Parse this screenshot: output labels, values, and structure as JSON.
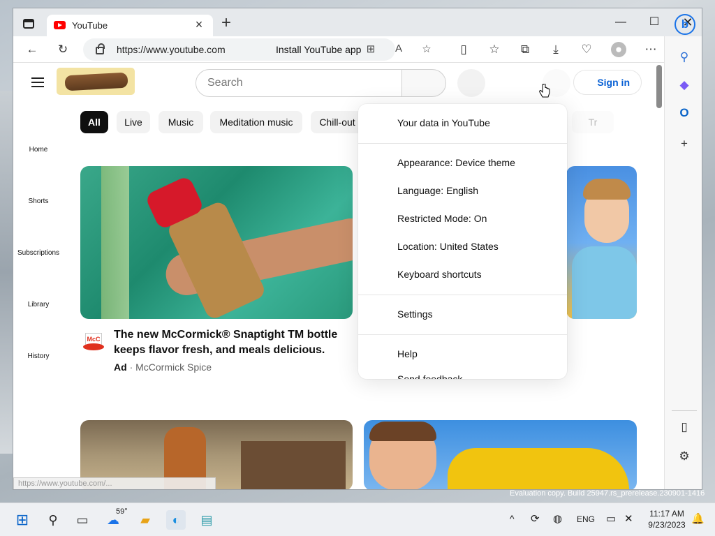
{
  "browser": {
    "tab_title": "YouTube",
    "url": "https://www.youtube.com",
    "install_prompt": "Install YouTube app"
  },
  "youtube": {
    "search_placeholder": "Search",
    "sign_in": "Sign in",
    "chips": [
      "All",
      "Live",
      "Music",
      "Meditation music",
      "Chill-out",
      "Tr"
    ],
    "sidenav": [
      "Home",
      "Shorts",
      "Subscriptions",
      "Library",
      "History"
    ],
    "video1": {
      "title": "The new McCormick® Snaptight TM bottle keeps flavor fresh, and meals delicious.",
      "ad_label": "Ad",
      "separator": "·",
      "channel": "McCormick Spice",
      "channel_badge": "McC"
    },
    "status_url": "https://www.youtube.com/..."
  },
  "menu": {
    "items": [
      "Your data in YouTube",
      "Appearance: Device theme",
      "Language: English",
      "Restricted Mode: On",
      "Location: United States",
      "Keyboard shortcuts",
      "Settings",
      "Help",
      "Send feedback"
    ]
  },
  "desktop": {
    "eval_text": "Evaluation copy. Build 25947.rs_prerelease.230901-1416"
  },
  "taskbar": {
    "weather": "59°",
    "lang": "ENG",
    "time": "11:17 AM",
    "date": "9/23/2023"
  },
  "colors": {
    "youtube_red": "#ff0000",
    "signin_blue": "#065fd4",
    "chip_active": "#0f0f0f"
  }
}
